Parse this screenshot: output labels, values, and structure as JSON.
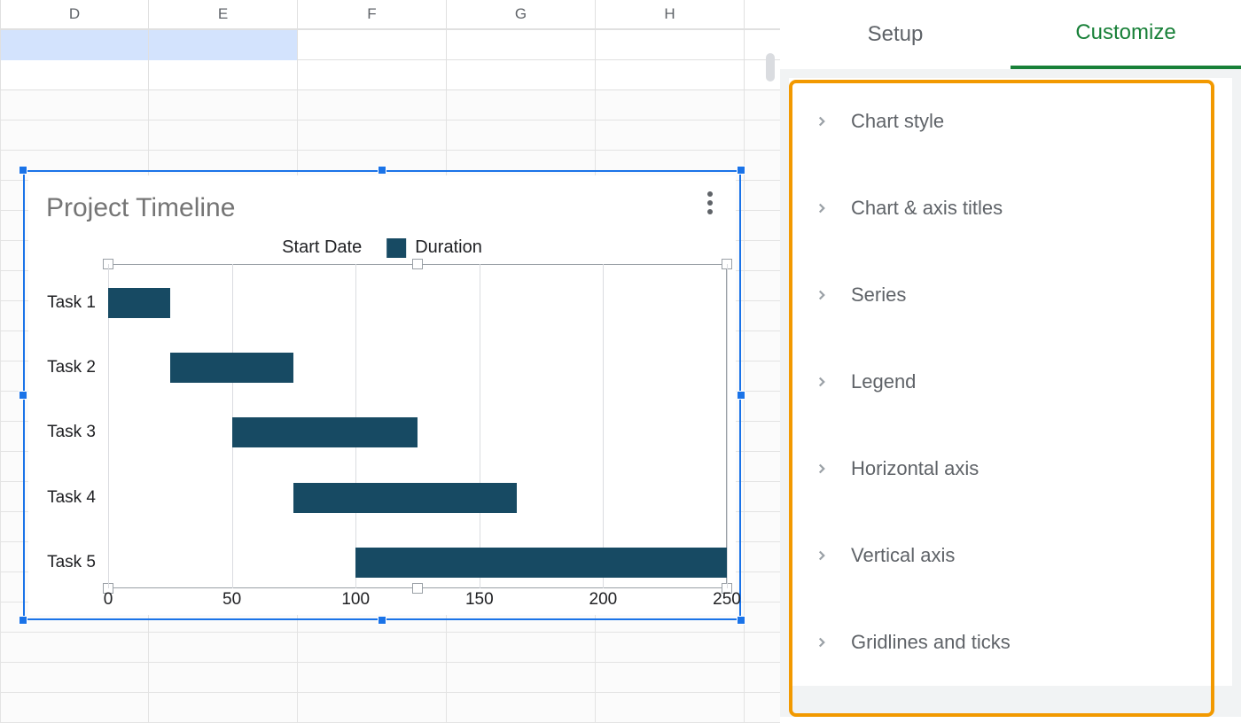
{
  "sheet": {
    "visible_columns": [
      "D",
      "E",
      "F",
      "G",
      "H"
    ]
  },
  "chart": {
    "title": "Project Timeline",
    "legend": {
      "series1": "Start Date",
      "series2": "Duration"
    },
    "x_ticks": [
      "0",
      "50",
      "100",
      "150",
      "200",
      "250"
    ],
    "y_ticks": [
      "Task 1",
      "Task 2",
      "Task 3",
      "Task 4",
      "Task 5"
    ]
  },
  "sidebar": {
    "tabs": {
      "setup": "Setup",
      "customize": "Customize"
    },
    "sections": [
      {
        "label": "Chart style"
      },
      {
        "label": "Chart & axis titles"
      },
      {
        "label": "Series"
      },
      {
        "label": "Legend"
      },
      {
        "label": "Horizontal axis"
      },
      {
        "label": "Vertical axis"
      },
      {
        "label": "Gridlines and ticks"
      }
    ]
  },
  "colors": {
    "bar": "#174a63",
    "selection": "#1a73e8",
    "accent_green": "#188038",
    "highlight": "#f29900"
  },
  "chart_data": {
    "type": "bar",
    "orientation": "horizontal",
    "stacked": true,
    "title": "Project Timeline",
    "xlabel": "",
    "ylabel": "",
    "xlim": [
      0,
      250
    ],
    "categories": [
      "Task 1",
      "Task 2",
      "Task 3",
      "Task 4",
      "Task 5"
    ],
    "series": [
      {
        "name": "Start Date",
        "values": [
          0,
          25,
          50,
          75,
          100
        ],
        "color": "transparent"
      },
      {
        "name": "Duration",
        "values": [
          25,
          50,
          75,
          90,
          150
        ],
        "color": "#174a63"
      }
    ],
    "legend_position": "top",
    "grid": true
  }
}
